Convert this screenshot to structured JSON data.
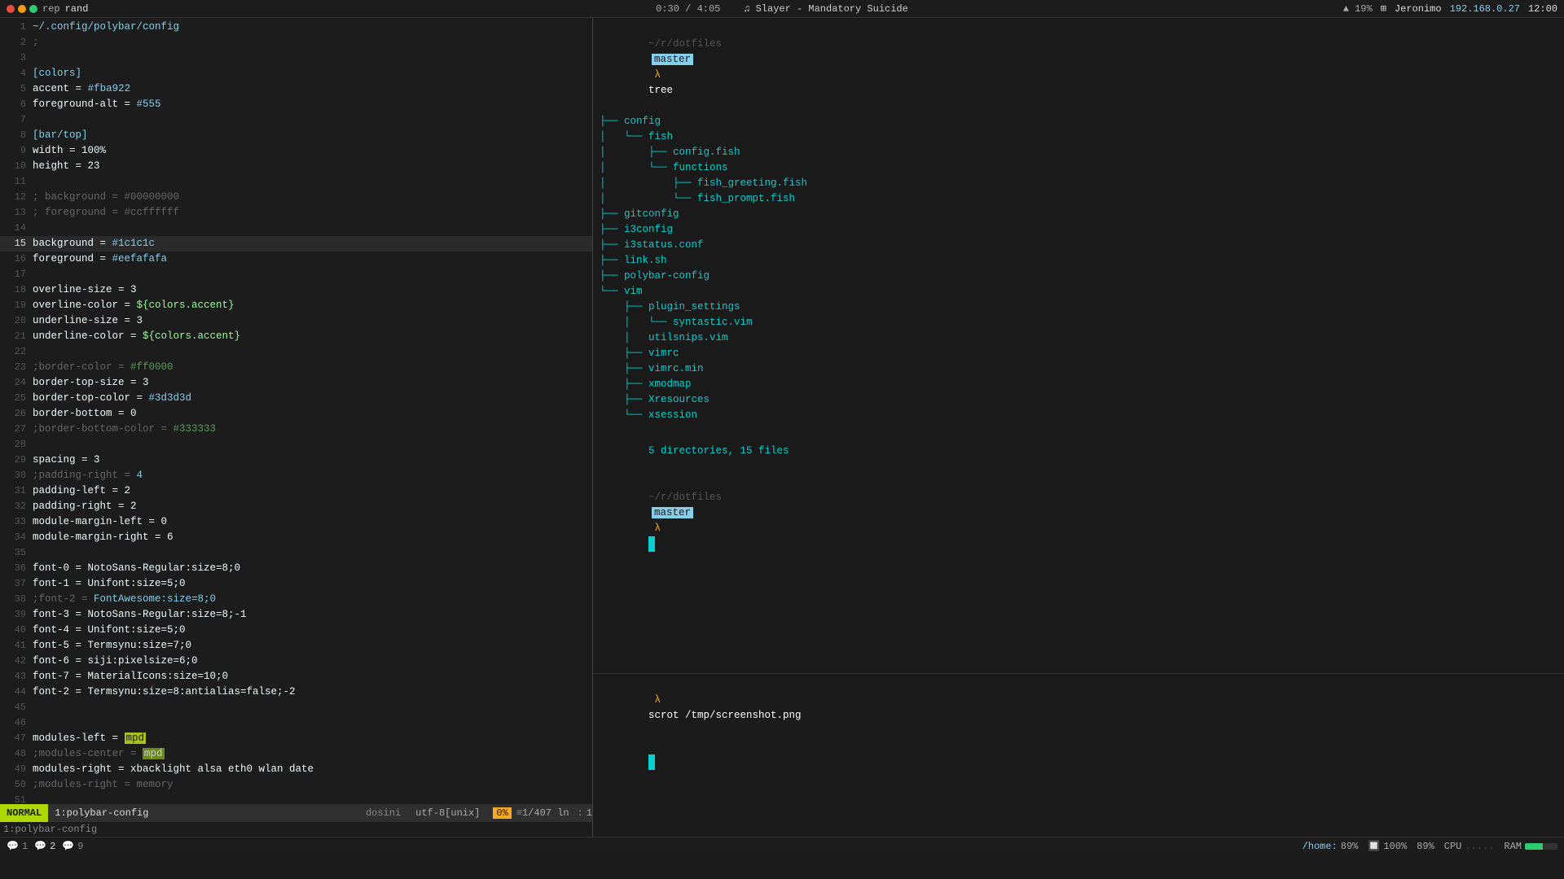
{
  "topbar": {
    "dots": [
      "red",
      "yellow",
      "green"
    ],
    "window_left": "rep",
    "window_name": "rand",
    "progress": "0:30 / 4:05",
    "song": "♫ Slayer - Mandatory Suicide",
    "battery_icon": "🔋",
    "battery_pct": "19%",
    "wifi_icon": "📶",
    "user": "Jeronimo",
    "ip": "192.168.0.27",
    "time": "12:00"
  },
  "editor": {
    "title": "~/config/polybar/config",
    "lines": [
      {
        "num": 1,
        "content": "~/.config/polybar/config",
        "type": "path"
      },
      {
        "num": 2,
        "content": ";"
      },
      {
        "num": 3,
        "content": ""
      },
      {
        "num": 4,
        "content": "[colors]",
        "type": "section"
      },
      {
        "num": 5,
        "content": "accent = #fba922"
      },
      {
        "num": 6,
        "content": "foreground-alt = #555"
      },
      {
        "num": 7,
        "content": ""
      },
      {
        "num": 8,
        "content": "[bar/top]",
        "type": "section"
      },
      {
        "num": 9,
        "content": "width = 100%"
      },
      {
        "num": 10,
        "content": "height = 23"
      },
      {
        "num": 11,
        "content": ""
      },
      {
        "num": 12,
        "content": "; background = #00000000",
        "type": "comment"
      },
      {
        "num": 13,
        "content": "; foreground = #ccffffff",
        "type": "comment"
      },
      {
        "num": 14,
        "content": ""
      },
      {
        "num": 15,
        "content": "background = #1c1c1c",
        "highlight": true
      },
      {
        "num": 16,
        "content": "foreground = #eefafafa"
      },
      {
        "num": 17,
        "content": ""
      },
      {
        "num": 18,
        "content": "overline-size = 3"
      },
      {
        "num": 19,
        "content": "overline-color = ${colors.accent}"
      },
      {
        "num": 20,
        "content": "underline-size = 3"
      },
      {
        "num": 21,
        "content": "underline-color = ${colors.accent}"
      },
      {
        "num": 22,
        "content": ""
      },
      {
        "num": 23,
        "content": ";border-color = #ff0000",
        "type": "comment"
      },
      {
        "num": 24,
        "content": "border-top-size = 3"
      },
      {
        "num": 25,
        "content": "border-top-color = #3d3d3d"
      },
      {
        "num": 26,
        "content": "border-bottom = 0"
      },
      {
        "num": 27,
        "content": ";border-bottom-color = #333333",
        "type": "comment"
      },
      {
        "num": 28,
        "content": ""
      },
      {
        "num": 29,
        "content": "spacing = 3"
      },
      {
        "num": 30,
        "content": ";padding-right = 4",
        "type": "comment"
      },
      {
        "num": 31,
        "content": "padding-left = 2"
      },
      {
        "num": 32,
        "content": "padding-right = 2"
      },
      {
        "num": 33,
        "content": "module-margin-left = 0"
      },
      {
        "num": 34,
        "content": "module-margin-right = 6"
      },
      {
        "num": 35,
        "content": ""
      },
      {
        "num": 36,
        "content": "font-0 = NotoSans-Regular:size=8;0"
      },
      {
        "num": 37,
        "content": "font-1 = Unifont:size=5;0"
      },
      {
        "num": 38,
        "content": ";font-2 = FontAwesome:size=8;0",
        "type": "comment"
      },
      {
        "num": 39,
        "content": "font-3 = NotoSans-Regular:size=8;-1"
      },
      {
        "num": 40,
        "content": "font-4 = Unifont:size=5;0"
      },
      {
        "num": 41,
        "content": "font-5 = Termsynu:size=7;0"
      },
      {
        "num": 42,
        "content": "font-6 = siji:pixelsize=6;0"
      },
      {
        "num": 43,
        "content": "font-7 = MaterialIcons:size=10;0"
      },
      {
        "num": 44,
        "content": "font-2 = Termsynu:size=8:antialias=false;-2"
      },
      {
        "num": 45,
        "content": ""
      },
      {
        "num": 46,
        "content": ""
      },
      {
        "num": 47,
        "content": "modules-left = mpd",
        "type": "modules-left"
      },
      {
        "num": 48,
        "content": ";modules-center = mpd",
        "type": "comment"
      },
      {
        "num": 49,
        "content": "modules-right = xbacklight alsa eth0 wlan date"
      },
      {
        "num": 50,
        "content": ";modules-right = memory",
        "type": "comment"
      },
      {
        "num": 51,
        "content": ""
      }
    ],
    "mode": "NORMAL",
    "filename": "1:polybar-config",
    "encoding": "utf-8[unix]",
    "progress_pct": "0%",
    "position": "1/407 ln",
    "col": "1",
    "bottom_label": "1:polybar-config"
  },
  "terminal_top": {
    "prompt_path": "~/r/dotfiles",
    "prompt_branch": "master",
    "command": "tree",
    "tree_lines": [
      {
        "indent": 0,
        "prefix": "├── ",
        "name": "config",
        "type": "dir"
      },
      {
        "indent": 1,
        "prefix": "└── ",
        "name": "fish",
        "type": "dir"
      },
      {
        "indent": 2,
        "prefix": "├── ",
        "name": "config.fish",
        "type": "file"
      },
      {
        "indent": 2,
        "prefix": "└── ",
        "name": "functions",
        "type": "dir"
      },
      {
        "indent": 3,
        "prefix": "├── ",
        "name": "fish_greeting.fish",
        "type": "file"
      },
      {
        "indent": 3,
        "prefix": "└── ",
        "name": "fish_prompt.fish",
        "type": "file"
      },
      {
        "indent": 0,
        "prefix": "├── ",
        "name": "gitconfig",
        "type": "file"
      },
      {
        "indent": 0,
        "prefix": "├── ",
        "name": "i3config",
        "type": "file"
      },
      {
        "indent": 0,
        "prefix": "├── ",
        "name": "i3status.conf",
        "type": "file"
      },
      {
        "indent": 0,
        "prefix": "├── ",
        "name": "link.sh",
        "type": "file"
      },
      {
        "indent": 0,
        "prefix": "├── ",
        "name": "polybar-config",
        "type": "file"
      },
      {
        "indent": 0,
        "prefix": "└── ",
        "name": "vim",
        "type": "dir"
      },
      {
        "indent": 1,
        "prefix": "├── ",
        "name": "plugin_settings",
        "type": "dir"
      },
      {
        "indent": 2,
        "prefix": "└── ",
        "name": "syntastic.vim",
        "type": "file"
      },
      {
        "indent": 2,
        "prefix": "",
        "name": "utilsnips.vim",
        "type": "file"
      },
      {
        "indent": 1,
        "prefix": "├── ",
        "name": "vimrc",
        "type": "file"
      },
      {
        "indent": 1,
        "prefix": "├── ",
        "name": "vimrc.min",
        "type": "file"
      },
      {
        "indent": 1,
        "prefix": "├── ",
        "name": "xmodmap",
        "type": "file"
      },
      {
        "indent": 1,
        "prefix": "├── ",
        "name": "Xresources",
        "type": "file"
      },
      {
        "indent": 1,
        "prefix": "└── ",
        "name": "xsession",
        "type": "file"
      }
    ],
    "summary": "5 directories, 15 files",
    "prompt2_path": "~/r/dotfiles",
    "prompt2_branch": "master"
  },
  "terminal_bottom": {
    "prompt_path": "",
    "command": "scrot /tmp/screenshot.png"
  },
  "bottombar": {
    "tabs": [
      {
        "num": "1",
        "icon": "💬",
        "label": "1",
        "active": false
      },
      {
        "num": "2",
        "icon": "💬",
        "label": "2",
        "active": true
      },
      {
        "num": "9",
        "icon": "💬",
        "label": "9",
        "active": false
      }
    ],
    "home_path": "/home:",
    "home_pct": "89%",
    "zoom": "100%",
    "right_pct": "89%",
    "cpu_label": "CPU",
    "cpu_dots": ".....",
    "ram_label": "RAM"
  }
}
